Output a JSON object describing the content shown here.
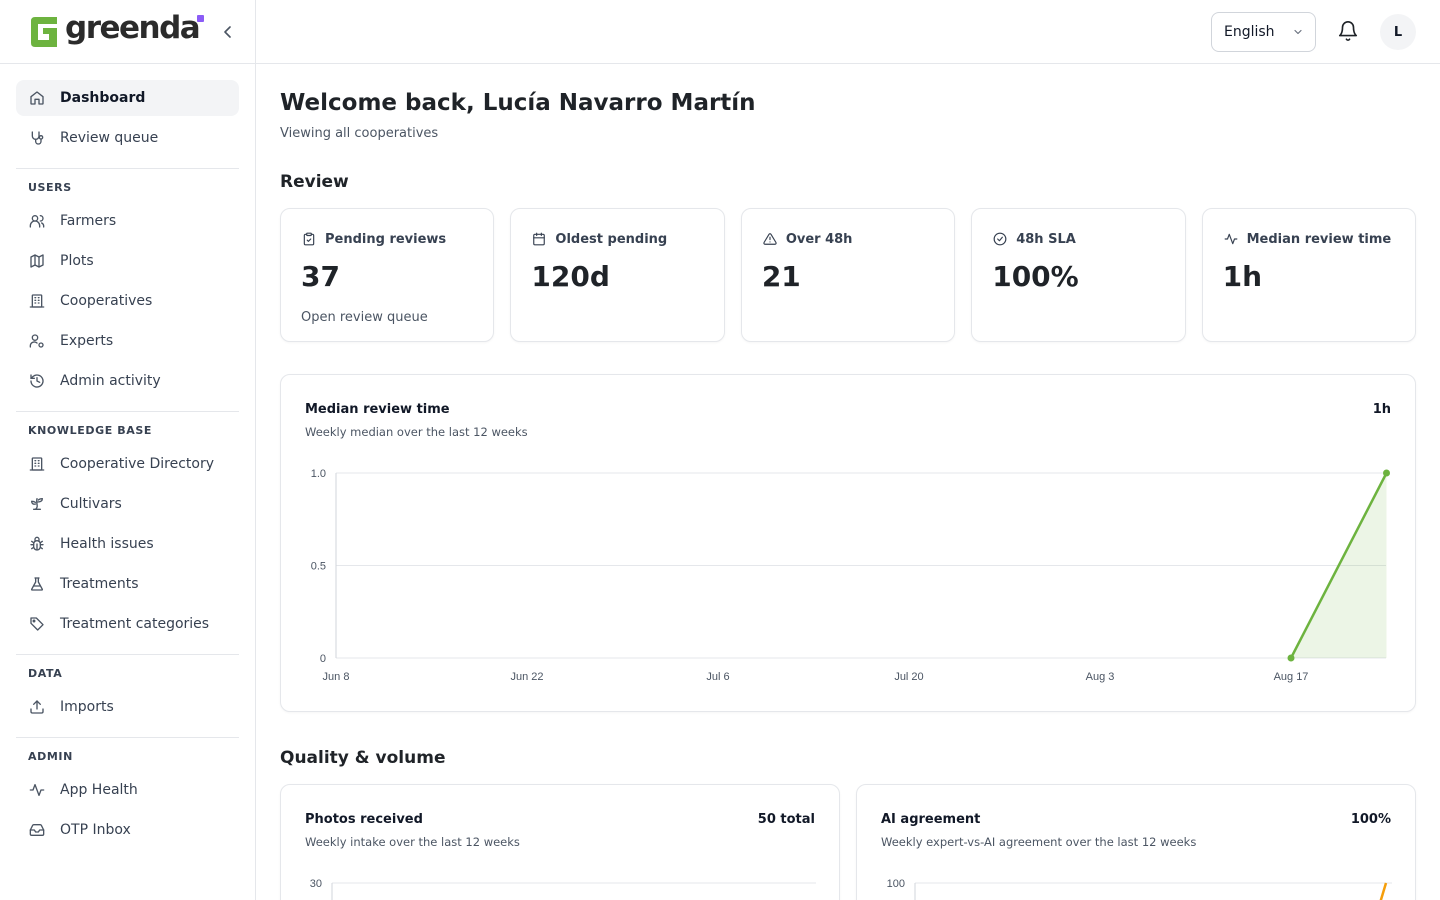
{
  "brand": {
    "name": "greenda",
    "accent": "#6db33f",
    "dot_color": "#8b5cf6"
  },
  "sidebar": {
    "primary": [
      {
        "label": "Dashboard",
        "icon": "home-icon",
        "active": true
      },
      {
        "label": "Review queue",
        "icon": "stethoscope-icon",
        "active": false
      }
    ],
    "groups": [
      {
        "title": "USERS",
        "items": [
          {
            "label": "Farmers",
            "icon": "users-icon"
          },
          {
            "label": "Plots",
            "icon": "map-icon"
          },
          {
            "label": "Cooperatives",
            "icon": "building-icon"
          },
          {
            "label": "Experts",
            "icon": "user-cog-icon"
          },
          {
            "label": "Admin activity",
            "icon": "history-icon"
          }
        ]
      },
      {
        "title": "KNOWLEDGE BASE",
        "items": [
          {
            "label": "Cooperative Directory",
            "icon": "building-icon"
          },
          {
            "label": "Cultivars",
            "icon": "sprout-icon"
          },
          {
            "label": "Health issues",
            "icon": "bug-icon"
          },
          {
            "label": "Treatments",
            "icon": "flask-icon"
          },
          {
            "label": "Treatment categories",
            "icon": "tag-icon"
          }
        ]
      },
      {
        "title": "DATA",
        "items": [
          {
            "label": "Imports",
            "icon": "upload-icon"
          }
        ]
      },
      {
        "title": "ADMIN",
        "items": [
          {
            "label": "App Health",
            "icon": "activity-icon"
          },
          {
            "label": "OTP Inbox",
            "icon": "inbox-icon"
          }
        ]
      }
    ]
  },
  "topbar": {
    "language": "English",
    "avatar_initial": "L"
  },
  "main": {
    "welcome": "Welcome back, Lucía Navarro Martín",
    "subtitle": "Viewing all cooperatives",
    "review_title": "Review",
    "quality_title": "Quality & volume"
  },
  "kpis": [
    {
      "label": "Pending reviews",
      "value": "37",
      "link": "Open review queue",
      "icon": "clipboard-icon"
    },
    {
      "label": "Oldest pending",
      "value": "120d",
      "link": "",
      "icon": "calendar-icon"
    },
    {
      "label": "Over 48h",
      "value": "21",
      "link": "",
      "icon": "alert-triangle-icon"
    },
    {
      "label": "48h SLA",
      "value": "100%",
      "link": "",
      "icon": "check-circle-icon"
    },
    {
      "label": "Median review time",
      "value": "1h",
      "link": "",
      "icon": "activity-icon"
    }
  ],
  "cards": {
    "median": {
      "title": "Median review time",
      "subtitle": "Weekly median over the last 12 weeks",
      "metric": "1h"
    },
    "photos": {
      "title": "Photos received",
      "subtitle": "Weekly intake over the last 12 weeks",
      "metric": "50 total"
    },
    "ai": {
      "title": "AI agreement",
      "subtitle": "Weekly expert-vs-AI agreement over the last 12 weeks",
      "metric": "100%"
    }
  },
  "chart_data": [
    {
      "type": "area",
      "title": "Median review time",
      "x_ticks": [
        "Jun 8",
        "Jun 22",
        "Jul 6",
        "Jul 20",
        "Aug 3",
        "Aug 17"
      ],
      "y_ticks": [
        "0",
        "0.5",
        "1.0"
      ],
      "ylim": [
        0,
        1
      ],
      "x": [
        "Aug 17",
        "Aug 24"
      ],
      "series": [
        {
          "values": [
            0,
            1
          ]
        }
      ],
      "color": "#6db33f",
      "grid": true
    },
    {
      "type": "bar",
      "title": "Photos received",
      "y_ticks": [
        "30"
      ],
      "ylim": [
        0,
        30
      ]
    },
    {
      "type": "line",
      "title": "AI agreement",
      "y_ticks": [
        "100"
      ],
      "ylim": [
        0,
        100
      ],
      "color": "#f59e0b"
    }
  ]
}
